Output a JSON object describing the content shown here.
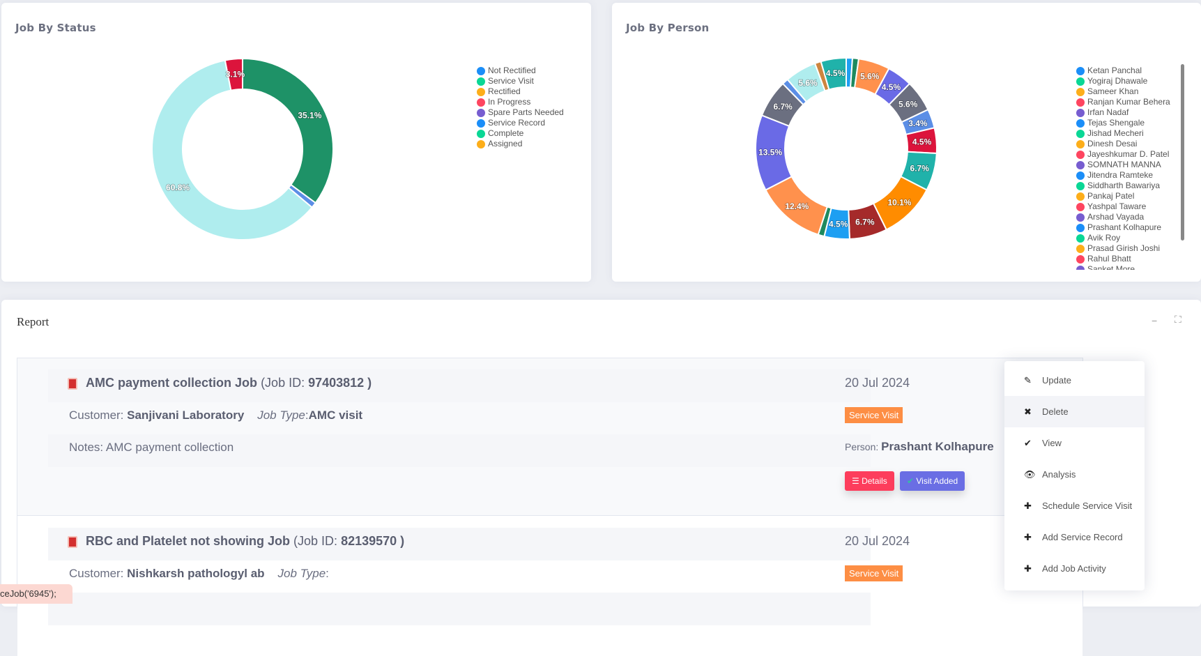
{
  "status_chart": {
    "title": "Job By Status",
    "chart_data": {
      "type": "pie",
      "donut": true,
      "slices": [
        {
          "value": 35.1,
          "label": "35.1%",
          "color": "#1e9267"
        },
        {
          "value": 1.0,
          "label": "",
          "color": "#5b8ee6"
        },
        {
          "value": 60.8,
          "label": "60.8%",
          "color": "#afedee"
        },
        {
          "value": 3.1,
          "label": "3.1%",
          "color": "#dc143c"
        }
      ],
      "legend_position": "right",
      "legend": [
        {
          "name": "Not Rectified",
          "color": "#1b8ef8"
        },
        {
          "name": "Service Visit",
          "color": "#0ad795"
        },
        {
          "name": "Rectified",
          "color": "#fdae1a"
        },
        {
          "name": "In Progress",
          "color": "#fe4560"
        },
        {
          "name": "Spare Parts Needed",
          "color": "#775dd0"
        },
        {
          "name": "Service Record",
          "color": "#1b8ef8"
        },
        {
          "name": "Complete",
          "color": "#0ad795"
        },
        {
          "name": "Assigned",
          "color": "#fdae1a"
        }
      ]
    }
  },
  "person_chart": {
    "title": "Job By Person",
    "chart_data": {
      "type": "pie",
      "donut": true,
      "slices": [
        {
          "value": 1.1,
          "label": "",
          "color": "#1e9ff2"
        },
        {
          "value": 1.1,
          "label": "",
          "color": "#1e8a5f"
        },
        {
          "value": 5.6,
          "label": "5.6%",
          "color": "#ff914d"
        },
        {
          "value": 4.5,
          "label": "4.5%",
          "color": "#6a6ae6"
        },
        {
          "value": 5.6,
          "label": "5.6%",
          "color": "#6b6f80"
        },
        {
          "value": 3.4,
          "label": "3.4%",
          "color": "#5b8ee6"
        },
        {
          "value": 4.5,
          "label": "4.5%",
          "color": "#dc143c"
        },
        {
          "value": 6.7,
          "label": "6.7%",
          "color": "#20b2aa"
        },
        {
          "value": 10.1,
          "label": "10.1%",
          "color": "#ff8c00"
        },
        {
          "value": 6.7,
          "label": "6.7%",
          "color": "#a52a2a"
        },
        {
          "value": 4.5,
          "label": "4.5%",
          "color": "#1e9ff2"
        },
        {
          "value": 1.1,
          "label": "",
          "color": "#1e8a5f"
        },
        {
          "value": 12.4,
          "label": "12.4%",
          "color": "#ff914d"
        },
        {
          "value": 13.5,
          "label": "13.5%",
          "color": "#6a6ae6"
        },
        {
          "value": 6.7,
          "label": "6.7%",
          "color": "#6b6f80"
        },
        {
          "value": 1.1,
          "label": "",
          "color": "#5b8ee6"
        },
        {
          "value": 5.6,
          "label": "5.6%",
          "color": "#afedee"
        },
        {
          "value": 1.1,
          "label": "",
          "color": "#cd853f"
        },
        {
          "value": 4.5,
          "label": "4.5%",
          "color": "#20b2aa"
        }
      ],
      "legend_position": "right",
      "legend": [
        {
          "name": "Ketan Panchal",
          "color": "#1b8ef8"
        },
        {
          "name": "Yogiraj Dhawale",
          "color": "#0ad795"
        },
        {
          "name": "Sameer Khan",
          "color": "#fdae1a"
        },
        {
          "name": "Ranjan Kumar Behera",
          "color": "#fe4560"
        },
        {
          "name": "Irfan Nadaf",
          "color": "#775dd0"
        },
        {
          "name": "Tejas Shengale",
          "color": "#1b8ef8"
        },
        {
          "name": "Jishad Mecheri",
          "color": "#0ad795"
        },
        {
          "name": "Dinesh Desai",
          "color": "#fdae1a"
        },
        {
          "name": "Jayeshkumar D. Patel",
          "color": "#fe4560"
        },
        {
          "name": "SOMNATH MANNA",
          "color": "#775dd0"
        },
        {
          "name": "Jitendra Ramteke",
          "color": "#1b8ef8"
        },
        {
          "name": "Siddharth Bawariya",
          "color": "#0ad795"
        },
        {
          "name": "Pankaj Patel",
          "color": "#fdae1a"
        },
        {
          "name": "Yashpal Taware",
          "color": "#fe4560"
        },
        {
          "name": "Arshad Vayada",
          "color": "#775dd0"
        },
        {
          "name": "Prashant Kolhapure",
          "color": "#1b8ef8"
        },
        {
          "name": "Avik Roy",
          "color": "#0ad795"
        },
        {
          "name": "Prasad Girish Joshi",
          "color": "#fdae1a"
        },
        {
          "name": "Rahul Bhatt",
          "color": "#fe4560"
        },
        {
          "name": "Sanket More",
          "color": "#775dd0"
        }
      ]
    }
  },
  "report": {
    "title": "Report",
    "minimize": "−",
    "fullscreen": "⛶",
    "jobs": [
      {
        "title": "AMC payment collection Job",
        "id_prefix": "(Job ID: ",
        "id": "97403812 )",
        "customer_label": "Customer: ",
        "customer": "Sanjivani Laboratory",
        "type_label": "Job Type",
        "type_sep": ":",
        "type": "AMC visit",
        "notes": "Notes: AMC payment collection",
        "date": "20 Jul 2024",
        "status": "Service Visit",
        "person_label": "Person: ",
        "person": "Prashant Kolhapure",
        "details": "Details",
        "visit": "Visit Added"
      },
      {
        "title": "RBC and Platelet not showing Job",
        "id_prefix": "(Job ID: ",
        "id": "82139570 )",
        "customer_label": "Customer: ",
        "customer": "Nishkarsh pathologyl ab",
        "type_label": "Job Type",
        "type_sep": ":",
        "type": "",
        "date": "20 Jul 2024",
        "status": "Service Visit"
      }
    ]
  },
  "menu": {
    "items": [
      {
        "label": "Update",
        "icon": "✎"
      },
      {
        "label": "Delete",
        "icon": "✖"
      },
      {
        "label": "View",
        "icon": "✔"
      },
      {
        "label": "Analysis",
        "icon": "👁"
      },
      {
        "label": "Schedule Service Visit",
        "icon": "✚"
      },
      {
        "label": "Add Service Record",
        "icon": "✚"
      },
      {
        "label": "Add Job Activity",
        "icon": "✚"
      }
    ]
  },
  "tooltip": "ceJob('6945');",
  "colors": {
    "details": "#fd3d5c",
    "visit": "#6a6ee4",
    "badge": "#fd8e44"
  }
}
